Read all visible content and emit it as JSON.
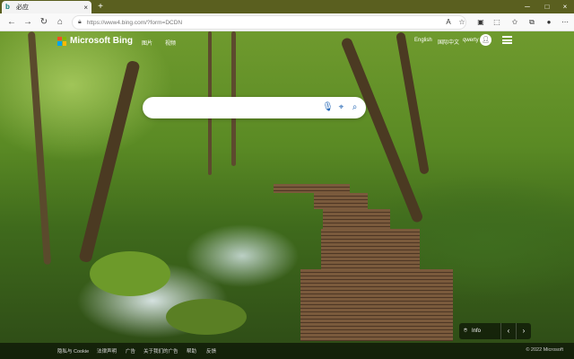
{
  "browser": {
    "tab": {
      "title": "必应",
      "favicon": "bing-icon",
      "close_glyph": "×"
    },
    "new_tab_glyph": "+",
    "window_controls": [
      "─",
      "□",
      "×"
    ],
    "nav": {
      "back": "←",
      "forward": "→",
      "refresh": "↻",
      "home": "⌂"
    },
    "address": {
      "url": "https://www4.bing.com/?form=DCDN"
    }
  },
  "header": {
    "logo_text": "Microsoft Bing",
    "logo_colors": [
      "#f25022",
      "#7fba00",
      "#00a4ef",
      "#ffb900"
    ],
    "nav_links": [
      "图片",
      "视频"
    ],
    "lang_english": "English",
    "lang_chinese": "国际中文",
    "username": "qwerty"
  },
  "search": {
    "value": "",
    "placeholder": ""
  },
  "image_info": {
    "label": "Info",
    "prev": "‹",
    "next": "›"
  },
  "footer": {
    "links": [
      "隐私与 Cookie",
      "法律声明",
      "广告",
      "关于我们的广告",
      "帮助",
      "反馈"
    ],
    "copyright": "© 2022 Microsoft"
  },
  "colors": {
    "accent": "#2064b4",
    "tabbar": "#5a5f1f"
  }
}
